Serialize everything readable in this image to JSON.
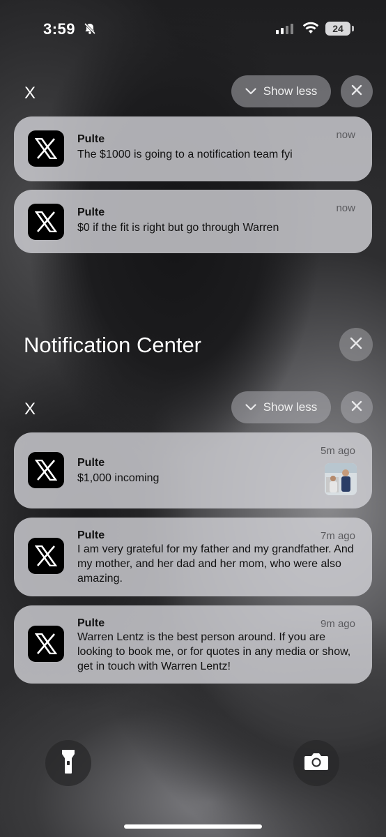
{
  "status_bar": {
    "time": "3:59",
    "battery": "24"
  },
  "group1": {
    "app_label": "X",
    "show_less": "Show less",
    "notifications": [
      {
        "title": "Pulte",
        "body": "The $1000 is going to a notification team fyi",
        "time": "now"
      },
      {
        "title": "Pulte",
        "body": "$0 if the fit is right but go through Warren",
        "time": "now"
      }
    ]
  },
  "notification_center": {
    "title": "Notification Center"
  },
  "group2": {
    "app_label": "X",
    "show_less": "Show less",
    "notifications": [
      {
        "title": "Pulte",
        "body": "$1,000 incoming",
        "time": "5m ago"
      },
      {
        "title": "Pulte",
        "body": "I am very grateful for my father and my grandfather. And my mother, and her dad and her mom, who were also amazing.",
        "time": "7m ago"
      },
      {
        "title": "Pulte",
        "body": "Warren Lentz is the best person around. If you are looking to book me, or for quotes in any media or show, get in touch with Warren Lentz!",
        "time": "9m ago"
      }
    ]
  },
  "icons": [
    "bell-slash-icon",
    "cellular-signal-icon",
    "wifi-icon",
    "battery-icon",
    "chevron-down-icon",
    "close-icon",
    "x-logo-icon",
    "flashlight-icon",
    "camera-icon"
  ]
}
